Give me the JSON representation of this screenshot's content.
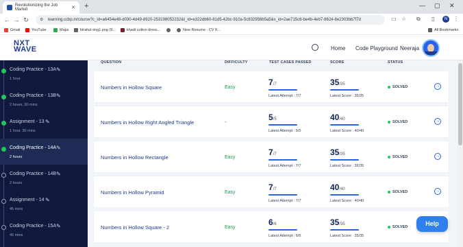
{
  "browser": {
    "tab_title": "Revolutionizing the Job Market",
    "url": "learning.ccbp.in/course?c_id=a6454e48-d030-4d49-8920-253198052232&t_id=e322db60-81d5-42bc-910a-5c832956b5a5&s_id=2ae715c6-be4b-4eb7-8624-8e2303bb7f7d",
    "profile_initial": "N",
    "bookmarks": [
      {
        "label": "Gmail",
        "icon": "gmail-icon",
        "color": "#ea4335"
      },
      {
        "label": "YouTube",
        "icon": "youtube-icon",
        "color": "#ff0000"
      },
      {
        "label": "Maps",
        "icon": "maps-icon",
        "color": "#34a853"
      },
      {
        "label": "ktrahul-img1.png (9...",
        "icon": "file-icon",
        "color": "#5f6368"
      },
      {
        "label": "khadi cotton dress...",
        "icon": "shop-icon",
        "color": "#7b1f2a"
      },
      {
        "label": "",
        "icon": "globe-icon",
        "color": "#5f6368"
      },
      {
        "label": "New Resume - CV K...",
        "icon": "globe-icon",
        "color": "#5f6368"
      }
    ],
    "all_bookmarks": "All Bookmarks"
  },
  "header": {
    "logo_main": "NXT",
    "logo_main2": "WAVE",
    "home": "Home",
    "code_playground": "Code Playground",
    "user_name": "Neeraja"
  },
  "sidebar": {
    "items": [
      {
        "title": "Coding Practice - 13A",
        "time": "1 hour",
        "done": true,
        "active": false
      },
      {
        "title": "Coding Practice - 13B",
        "time": "2 hours, 30 mins",
        "done": true,
        "active": false
      },
      {
        "title": "Assignment - 13",
        "time": "1 hour, 30 mins",
        "done": true,
        "active": false
      },
      {
        "title": "Coding Practice - 14A",
        "time": "2 hours",
        "done": true,
        "active": true
      },
      {
        "title": "Coding Practice - 14B",
        "time": "2 hours",
        "done": false,
        "active": false
      },
      {
        "title": "Assignment - 14",
        "time": "45 mins",
        "done": false,
        "active": false
      },
      {
        "title": "Coding Practice - 15A",
        "time": "45 mins",
        "done": false,
        "active": false
      }
    ]
  },
  "table": {
    "headers": {
      "question": "QUESTION",
      "difficulty": "DIFFICULTY",
      "test_cases": "TEST CASES PASSED",
      "score": "SCORE",
      "status": "STATUS"
    },
    "rows": [
      {
        "question": "Numbers in Hollow Square",
        "difficulty": "Easy",
        "passed": "7",
        "passed_total": "/7",
        "attempt": "Latest Attempt : 7/7",
        "score": "35",
        "score_total": "/35",
        "latest_score": "Latest Score : 35/35",
        "status": "SOLVED"
      },
      {
        "question": "Numbers in Hollow Right Angled Triangle",
        "difficulty": "-",
        "passed": "5",
        "passed_total": "/5",
        "attempt": "Latest Attempt : 5/5",
        "score": "40",
        "score_total": "/40",
        "latest_score": "Latest Score : 40/40",
        "status": "SOLVED"
      },
      {
        "question": "Numbers in Hollow Rectangle",
        "difficulty": "Easy",
        "passed": "7",
        "passed_total": "/7",
        "attempt": "Latest Attempt : 7/7",
        "score": "35",
        "score_total": "/35",
        "latest_score": "Latest Score : 35/35",
        "status": "SOLVED"
      },
      {
        "question": "Numbers in Hollow Pyramid",
        "difficulty": "Easy",
        "passed": "7",
        "passed_total": "/7",
        "attempt": "Latest Attempt : 7/7",
        "score": "40",
        "score_total": "/40",
        "latest_score": "Latest Score : 40/40",
        "status": "SOLVED"
      },
      {
        "question": "Numbers in Hollow Square - 2",
        "difficulty": "Easy",
        "passed": "6",
        "passed_total": "/6",
        "attempt": "Latest Attempt : 6/6",
        "score": "35",
        "score_total": "/35",
        "latest_score": "Latest Score : 35/35",
        "status": "SOLVED"
      }
    ]
  },
  "help_label": "Help",
  "colors": {
    "sidebar_bg": "#0f1a3e",
    "accent": "#2563eb",
    "easy": "#16a34a",
    "solved_dot": "#22c55e",
    "help": "#2f80ed"
  }
}
